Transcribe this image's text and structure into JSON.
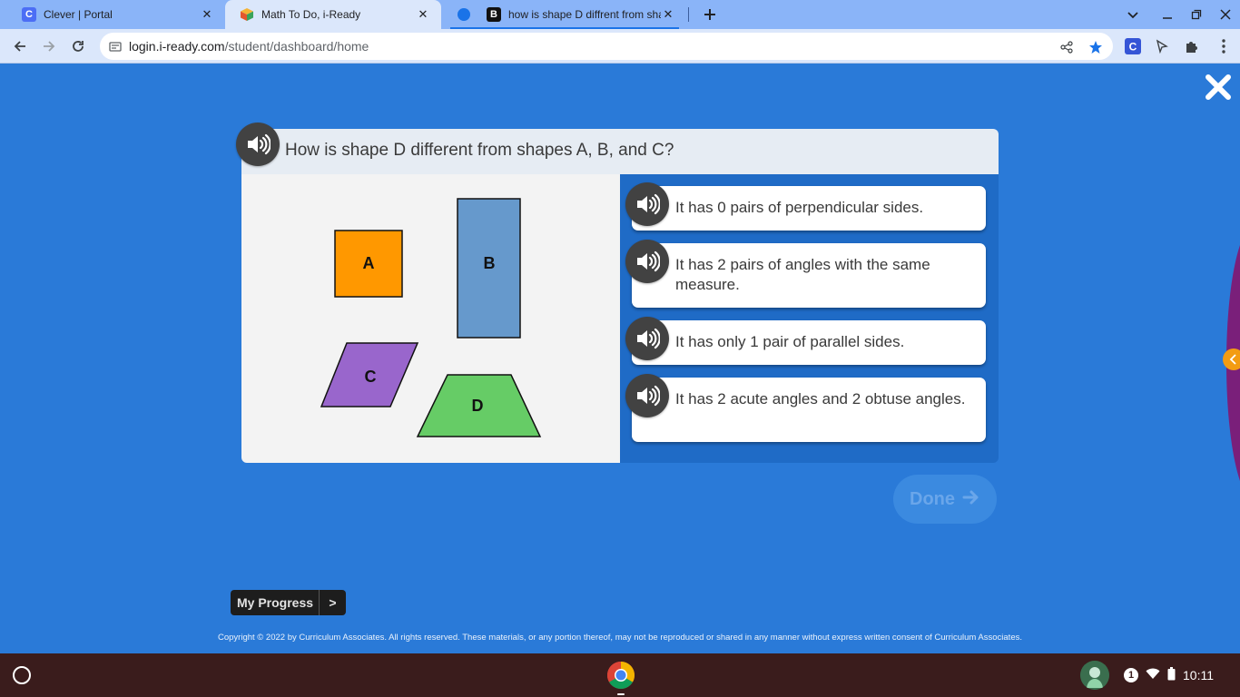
{
  "browser": {
    "tabs": [
      {
        "title": "Clever | Portal",
        "favicon": "clever-c-icon",
        "favicon_letter": "C",
        "favicon_color": "#4c6ef5"
      },
      {
        "title": "Math To Do, i-Ready",
        "favicon": "iready-cube-icon"
      },
      {
        "title": "how is shape D diffrent from sha",
        "favicon": "brainly-b-icon",
        "favicon_letter": "B",
        "active": true
      }
    ],
    "url_host": "login.i-ready.com",
    "url_path": "/student/dashboard/home"
  },
  "question": {
    "text": "How is shape D different from shapes A, B, and C?"
  },
  "shapes": [
    {
      "label": "A",
      "kind": "square",
      "color": "#ff9800"
    },
    {
      "label": "B",
      "kind": "rectangle",
      "color": "#6699cc"
    },
    {
      "label": "C",
      "kind": "parallelogram",
      "color": "#9966cc"
    },
    {
      "label": "D",
      "kind": "trapezoid",
      "color": "#66cc66"
    }
  ],
  "answers": [
    {
      "text": "It has 0 pairs of perpendicular sides."
    },
    {
      "text": "It has 2 pairs of angles with the same measure."
    },
    {
      "text": "It has only 1 pair of parallel sides."
    },
    {
      "text": "It has 2 acute angles and 2 obtuse angles."
    }
  ],
  "done_label": "Done",
  "progress_label": "My Progress",
  "progress_chevron": ">",
  "copyright": "Copyright © 2022 by Curriculum Associates. All rights reserved. These materials, or any portion thereof, may not be reproduced or shared in any manner without express written consent of Curriculum Associates.",
  "shelf": {
    "notification_count": "1",
    "time": "10:11"
  },
  "colors": {
    "page_bg": "#2a7ad8",
    "answers_panel": "#1f6bc6",
    "done_disabled": "#3b8ae0"
  }
}
